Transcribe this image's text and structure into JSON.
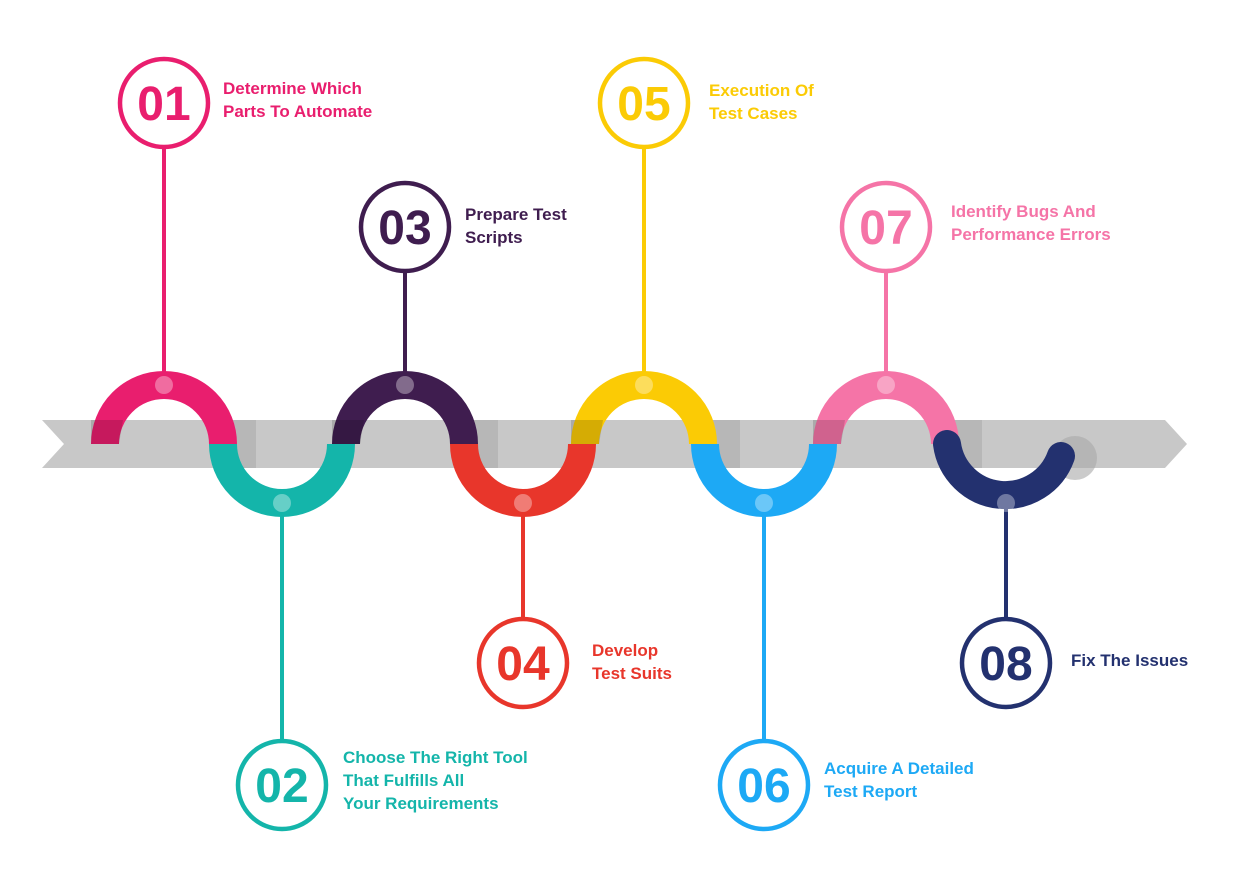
{
  "colors": {
    "arrow": "#c8c8c8",
    "arrow_shadow": "#a9a9a9",
    "background": "#ffffff"
  },
  "steps": [
    {
      "number": "01",
      "lines": [
        "Determine Which",
        "Parts To Automate"
      ],
      "color": "#e91e6e"
    },
    {
      "number": "02",
      "lines": [
        "Choose The Right Tool",
        "That Fulfills All",
        "Your Requirements"
      ],
      "color": "#14b5aa"
    },
    {
      "number": "03",
      "lines": [
        "Prepare Test",
        "Scripts"
      ],
      "color": "#3f1d4f"
    },
    {
      "number": "04",
      "lines": [
        "Develop",
        "Test Suits"
      ],
      "color": "#e8362b"
    },
    {
      "number": "05",
      "lines": [
        "Execution Of",
        "Test Cases"
      ],
      "color": "#fbcb05"
    },
    {
      "number": "06",
      "lines": [
        "Acquire A Detailed",
        "Test Report"
      ],
      "color": "#1da9f5"
    },
    {
      "number": "07",
      "lines": [
        "Identify Bugs And",
        "Performance Errors"
      ],
      "color": "#f574a7"
    },
    {
      "number": "08",
      "lines": [
        "Fix The Issues"
      ],
      "color": "#23316f"
    }
  ]
}
